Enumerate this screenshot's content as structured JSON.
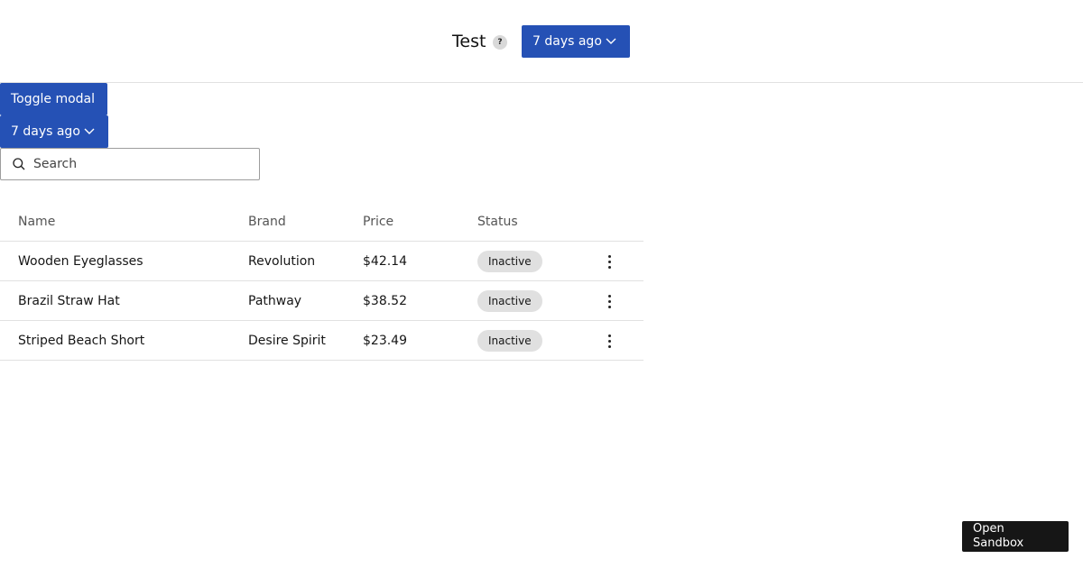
{
  "header": {
    "title": "Test",
    "help_glyph": "?",
    "date_filter_label": "7 days ago"
  },
  "toolbar": {
    "toggle_modal_label": "Toggle modal",
    "date_filter_label": "7 days ago"
  },
  "search": {
    "placeholder": "Search",
    "value": ""
  },
  "table": {
    "columns": [
      "Name",
      "Brand",
      "Price",
      "Status"
    ],
    "rows": [
      {
        "name": "Wooden Eyeglasses",
        "brand": "Revolution",
        "price": "$42.14",
        "status": "Inactive"
      },
      {
        "name": "Brazil Straw Hat",
        "brand": "Pathway",
        "price": "$38.52",
        "status": "Inactive"
      },
      {
        "name": "Striped Beach Short",
        "brand": "Desire Spirit",
        "price": "$23.49",
        "status": "Inactive"
      }
    ]
  },
  "footer": {
    "open_sandbox_label": "Open Sandbox"
  },
  "icons": {
    "help": "help-icon",
    "chevron": "chevron-down-icon",
    "search": "search-icon",
    "row_menu": "overflow-menu-icon"
  },
  "colors": {
    "primary_button": "#2551b5",
    "badge_background": "#e0e0e0",
    "sandbox_button": "#161616"
  }
}
